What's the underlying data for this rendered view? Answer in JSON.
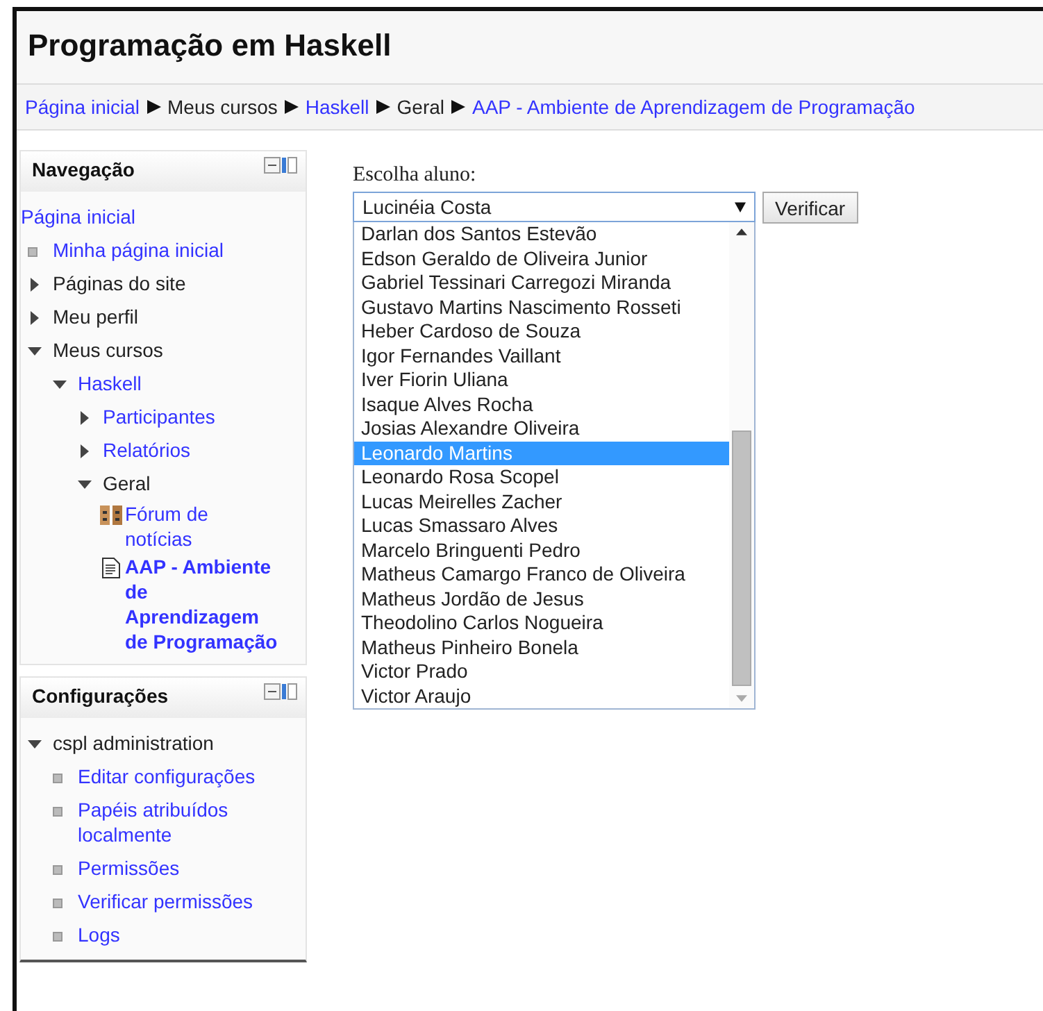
{
  "page_title": "Programação em Haskell",
  "breadcrumb": [
    {
      "label": "Página inicial",
      "link": true
    },
    {
      "label": "Meus cursos",
      "link": false
    },
    {
      "label": "Haskell",
      "link": true
    },
    {
      "label": "Geral",
      "link": false
    },
    {
      "label": "AAP - Ambiente de Aprendizagem de Programação",
      "link": true
    }
  ],
  "navigation": {
    "title": "Navegação",
    "items": [
      {
        "label": "Página inicial",
        "kind": "plain",
        "link": true
      },
      {
        "label": "Minha página inicial",
        "kind": "leaf",
        "link": true
      },
      {
        "label": "Páginas do site",
        "kind": "branch",
        "link": false,
        "expanded": false
      },
      {
        "label": "Meu perfil",
        "kind": "branch",
        "link": false,
        "expanded": false
      },
      {
        "label": "Meus cursos",
        "kind": "branch",
        "link": false,
        "expanded": true,
        "children": [
          {
            "label": "Haskell",
            "kind": "branch",
            "link": true,
            "expanded": true,
            "children": [
              {
                "label": "Participantes",
                "kind": "branch",
                "link": true,
                "expanded": false
              },
              {
                "label": "Relatórios",
                "kind": "branch",
                "link": true,
                "expanded": false
              },
              {
                "label": "Geral",
                "kind": "branch",
                "link": false,
                "expanded": true,
                "children": [
                  {
                    "label": "Fórum de notícias",
                    "kind": "forum",
                    "link": true,
                    "current": false
                  },
                  {
                    "label": "AAP - Ambiente de Aprendizagem de Programação",
                    "kind": "page",
                    "link": true,
                    "current": true
                  }
                ]
              }
            ]
          }
        ]
      }
    ]
  },
  "settings": {
    "title": "Configurações",
    "items": [
      {
        "label": "cspl administration",
        "kind": "branch",
        "link": false,
        "expanded": true,
        "children": [
          {
            "label": "Editar configurações",
            "kind": "leaf",
            "link": true
          },
          {
            "label": "Papéis atribuídos localmente",
            "kind": "leaf",
            "link": true
          },
          {
            "label": "Permissões",
            "kind": "leaf",
            "link": true
          },
          {
            "label": "Verificar permissões",
            "kind": "leaf",
            "link": true
          },
          {
            "label": "Logs",
            "kind": "leaf",
            "link": true
          }
        ]
      }
    ]
  },
  "form": {
    "label": "Escolha aluno:",
    "value": "Lucinéia Costa",
    "button": "Verificar",
    "options": [
      {
        "label": "Darlan dos Santos Estevão",
        "selected": false
      },
      {
        "label": "Edson Geraldo de Oliveira Junior",
        "selected": false
      },
      {
        "label": "Gabriel Tessinari Carregozi Miranda",
        "selected": false
      },
      {
        "label": "Gustavo Martins Nascimento Rosseti",
        "selected": false
      },
      {
        "label": "Heber Cardoso de Souza",
        "selected": false
      },
      {
        "label": "Igor Fernandes Vaillant",
        "selected": false
      },
      {
        "label": "Iver Fiorin Uliana",
        "selected": false
      },
      {
        "label": "Isaque Alves Rocha",
        "selected": false
      },
      {
        "label": "Josias Alexandre Oliveira",
        "selected": false
      },
      {
        "label": "Leonardo Martins",
        "selected": true
      },
      {
        "label": "Leonardo Rosa Scopel",
        "selected": false
      },
      {
        "label": "Lucas Meirelles Zacher",
        "selected": false
      },
      {
        "label": "Lucas Smassaro Alves",
        "selected": false
      },
      {
        "label": "Marcelo Bringuenti Pedro",
        "selected": false
      },
      {
        "label": "Matheus Camargo Franco de Oliveira",
        "selected": false
      },
      {
        "label": "Matheus Jordão de Jesus",
        "selected": false
      },
      {
        "label": "Theodolino Carlos Nogueira",
        "selected": false
      },
      {
        "label": "Matheus Pinheiro Bonela",
        "selected": false
      },
      {
        "label": "Victor Prado",
        "selected": false
      },
      {
        "label": "Victor Araujo",
        "selected": false
      }
    ]
  }
}
